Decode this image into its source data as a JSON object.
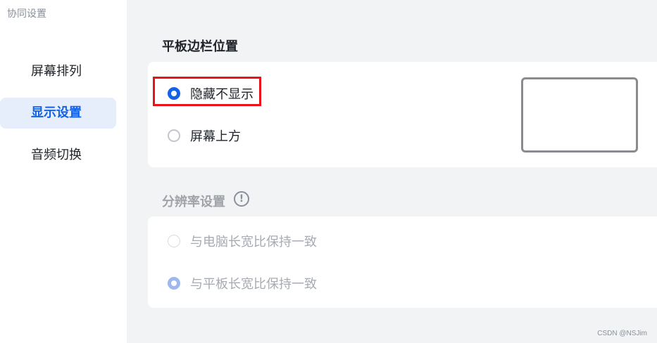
{
  "window": {
    "title": "协同设置"
  },
  "sidebar": {
    "items": [
      {
        "label": "屏幕排列",
        "active": false
      },
      {
        "label": "显示设置",
        "active": true
      },
      {
        "label": "音频切换",
        "active": false
      }
    ]
  },
  "sections": {
    "sidebar_position": {
      "title": "平板边栏位置",
      "options": [
        {
          "label": "隐藏不显示",
          "selected": true
        },
        {
          "label": "屏幕上方",
          "selected": false
        }
      ]
    },
    "resolution": {
      "title": "分辨率设置",
      "info_icon": "info-icon",
      "options": [
        {
          "label": "与电脑长宽比保持一致",
          "selected": false,
          "disabled": true
        },
        {
          "label": "与平板长宽比保持一致",
          "selected": true,
          "disabled": true
        }
      ]
    }
  },
  "watermark": "CSDN @NSJim",
  "colors": {
    "accent": "#1463e6",
    "active_bg": "#e6eefb",
    "highlight": "#e8141a",
    "disabled_text": "#a7abb2"
  }
}
